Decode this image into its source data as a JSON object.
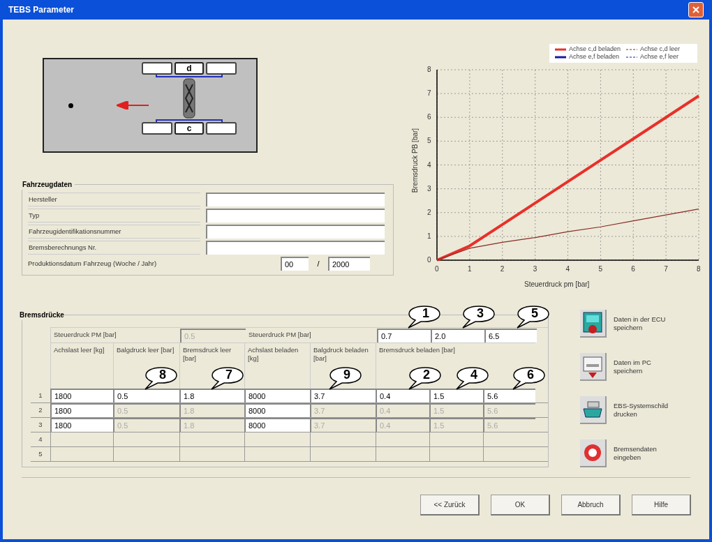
{
  "window": {
    "title": "TEBS Parameter"
  },
  "diagram": {
    "axle_labels": [
      "d",
      "c"
    ]
  },
  "chart_data": {
    "type": "line",
    "xlabel": "Steuerdruck pm [bar]",
    "ylabel": "Bremsdruck PB [bar]",
    "x": [
      0,
      1,
      2,
      3,
      4,
      5,
      6,
      7,
      8
    ],
    "xlim": [
      0,
      8
    ],
    "ylim": [
      0,
      8
    ],
    "xticks": [
      0,
      1,
      2,
      3,
      4,
      5,
      6,
      7,
      8
    ],
    "grid": true,
    "legend": true,
    "yticks": [
      0,
      1,
      2,
      3,
      4,
      5,
      6,
      7,
      8
    ],
    "series": [
      {
        "name": "Achse c,d beladen",
        "color": "#e8302a",
        "values": [
          0,
          0.6,
          1.5,
          2.4,
          3.3,
          4.2,
          5.1,
          6.0,
          6.9
        ]
      },
      {
        "name": "Achse c,d leer",
        "color": "#8a2a24",
        "values": [
          0,
          0.5,
          0.75,
          0.95,
          1.2,
          1.4,
          1.65,
          1.9,
          2.15
        ]
      },
      {
        "name": "Achse e,f beladen",
        "color": "#1a1aa0",
        "values": [
          null,
          null,
          null,
          null,
          null,
          null,
          null,
          null,
          null
        ]
      },
      {
        "name": "Achse e,f leer",
        "color": "#1a1aa0",
        "values": [
          null,
          null,
          null,
          null,
          null,
          null,
          null,
          null,
          null
        ]
      }
    ]
  },
  "vehicle": {
    "title": "Fahrzeugdaten",
    "fields": [
      {
        "label": "Hersteller"
      },
      {
        "label": "Typ"
      },
      {
        "label": "Fahrzeugidentifikationsnummer"
      },
      {
        "label": "Bremsberechnungs Nr."
      }
    ],
    "production": {
      "label": "Produktionsdatum Fahrzeug (Woche / Jahr)",
      "week": "00",
      "separator": "/",
      "year": "2000"
    }
  },
  "pressures": {
    "title": "Bremsdrücke",
    "pm_empty": {
      "label": "Steuerdruck PM [bar]",
      "value": "0.5",
      "disabled": true
    },
    "pm_loaded": {
      "label": "Steuerdruck PM [bar]",
      "values": [
        "0.7",
        "2.0",
        "6.5"
      ]
    },
    "columns": [
      "Achslast leer [kg]",
      "Balgdruck leer [bar]",
      "Bremsdruck leer [bar]",
      "Achslast beladen [kg]",
      "Balgdruck beladen [bar]",
      "Bremsdruck beladen [bar]"
    ],
    "rows": [
      {
        "number": "1",
        "cells": [
          {
            "value": "1800",
            "disabled": false
          },
          {
            "value": "0.5",
            "disabled": false
          },
          {
            "value": "1.8",
            "disabled": false
          },
          {
            "value": "8000",
            "disabled": false
          },
          {
            "value": "3.7",
            "disabled": false
          },
          {
            "value": "0.4",
            "disabled": false
          },
          {
            "value": "1.5",
            "disabled": false
          },
          {
            "value": "5.6",
            "disabled": false
          }
        ]
      },
      {
        "number": "2",
        "cells": [
          {
            "value": "1800",
            "disabled": false
          },
          {
            "value": "0.5",
            "disabled": true
          },
          {
            "value": "1.8",
            "disabled": true
          },
          {
            "value": "8000",
            "disabled": false
          },
          {
            "value": "3.7",
            "disabled": true
          },
          {
            "value": "0.4",
            "disabled": true
          },
          {
            "value": "1.5",
            "disabled": true
          },
          {
            "value": "5.6",
            "disabled": true
          }
        ]
      },
      {
        "number": "3",
        "cells": [
          {
            "value": "1800",
            "disabled": false
          },
          {
            "value": "0.5",
            "disabled": true
          },
          {
            "value": "1.8",
            "disabled": true
          },
          {
            "value": "8000",
            "disabled": false
          },
          {
            "value": "3.7",
            "disabled": true
          },
          {
            "value": "0.4",
            "disabled": true
          },
          {
            "value": "1.5",
            "disabled": true
          },
          {
            "value": "5.6",
            "disabled": true
          }
        ]
      },
      {
        "number": "4",
        "cells": []
      },
      {
        "number": "5",
        "cells": []
      }
    ]
  },
  "actions": [
    {
      "kind": "ecu",
      "label": "Daten in der ECU speichern"
    },
    {
      "kind": "pc",
      "label": "Daten im PC speichern"
    },
    {
      "kind": "print",
      "label": "EBS-Systemschild drucken"
    },
    {
      "kind": "brake",
      "label": "Bremsendaten eingeben"
    }
  ],
  "callouts": [
    "1",
    "3",
    "5",
    "8",
    "7",
    "9",
    "2",
    "4",
    "6"
  ],
  "buttons": [
    "<< Zurück",
    "OK",
    "Abbruch",
    "Hilfe"
  ]
}
